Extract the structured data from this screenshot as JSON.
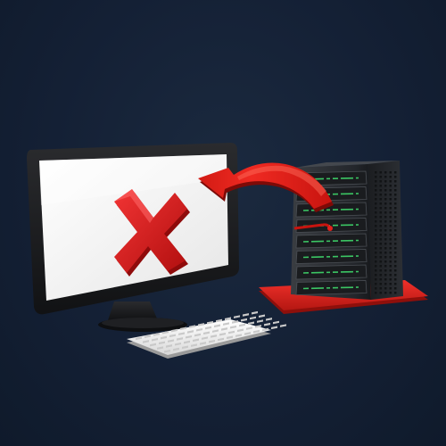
{
  "scene": {
    "description_icons": [
      "monitor-icon",
      "error-x-icon",
      "server-rack-icon",
      "red-arrow-icon",
      "keyboard-icon"
    ],
    "colors": {
      "background": "#142035",
      "monitor_bezel": "#1a1a1c",
      "screen": "#f2f2f2",
      "error_x": "#e01b1b",
      "server_body": "#26292e",
      "server_led": "#3fd86b",
      "server_base": "#e3201b",
      "arrow": "#e3201b",
      "keyboard": "#f4f4f4"
    },
    "status": "error"
  }
}
